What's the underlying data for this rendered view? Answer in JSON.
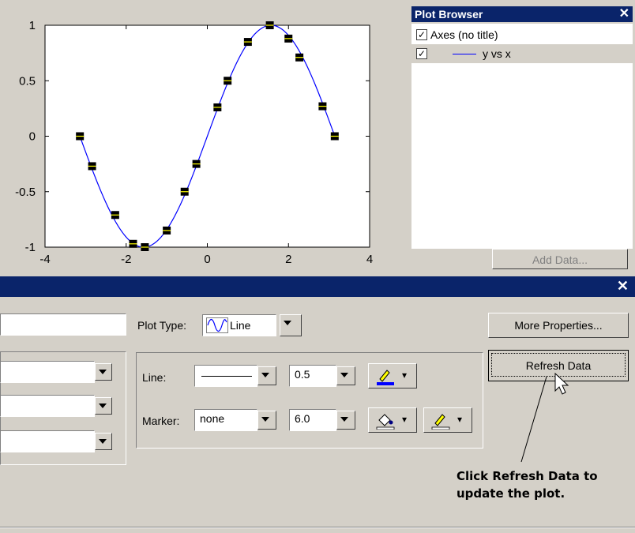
{
  "chart_data": {
    "type": "line",
    "title": "",
    "xlabel": "",
    "ylabel": "",
    "xlim": [
      -4,
      4
    ],
    "ylim": [
      -1,
      1
    ],
    "xticks": [
      "-4",
      "-2",
      "0",
      "2",
      "4"
    ],
    "yticks": [
      "1",
      "0.5",
      "0",
      "-0.5",
      "-1"
    ],
    "grid": false,
    "series": [
      {
        "function": "sin",
        "line_color": "#0000ff",
        "marker": "square",
        "marker_color": "#000000",
        "x": [
          -3.14,
          -2.84,
          -2.27,
          -1.83,
          -1.54,
          -1.0,
          -0.56,
          -0.27,
          0.25,
          0.5,
          1.0,
          1.54,
          2.0,
          2.27,
          2.84,
          3.14
        ],
        "y": [
          0.0,
          -0.27,
          -0.71,
          -0.97,
          -1.0,
          -0.85,
          -0.5,
          -0.25,
          0.26,
          0.5,
          0.85,
          1.0,
          0.88,
          0.71,
          0.27,
          0.0
        ]
      }
    ]
  },
  "plot_browser": {
    "title": "Plot Browser",
    "close_glyph": "✕",
    "items": [
      {
        "label": "Axes (no title)",
        "checked": "✓"
      },
      {
        "label": "y vs x",
        "checked": "✓"
      }
    ],
    "add_data_label": "Add Data..."
  },
  "property_editor": {
    "close_glyph": "✕",
    "plot_type_label": "Plot Type:",
    "plot_type_value": "Line",
    "more_properties_label": "More Properties...",
    "refresh_data_label": "Refresh Data",
    "line_label": "Line:",
    "line_width": "0.5",
    "marker_label": "Marker:",
    "marker_value": "none",
    "marker_size": "6.0",
    "line_color": "#0000ff"
  },
  "callout": {
    "line1": "Click Refresh Data to",
    "line2": "update the plot."
  }
}
